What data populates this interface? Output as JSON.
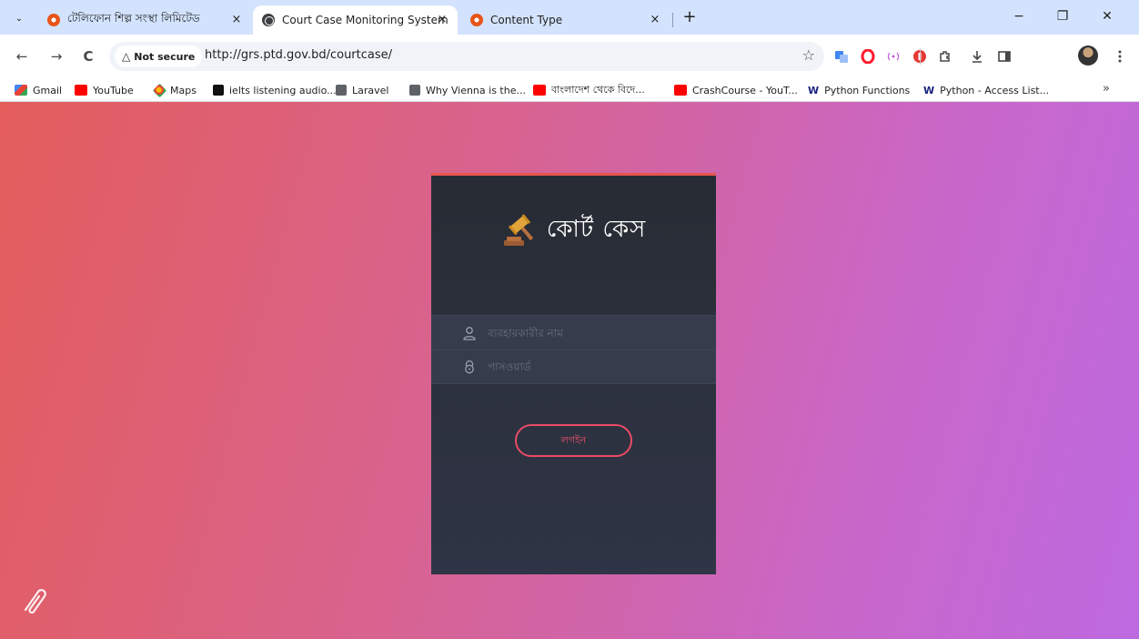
{
  "browser": {
    "tabs": [
      {
        "title": "টেলিফোন শিল্প সংস্থা লিমিটেড",
        "active": false,
        "favicon": "ptd-logo"
      },
      {
        "title": "Court Case Monitoring System",
        "active": true,
        "favicon": "globe-icon"
      },
      {
        "title": "Content Type",
        "active": false,
        "favicon": "ptd-logo"
      }
    ],
    "tab_close": "×",
    "new_tab": "+",
    "window": {
      "minimize": "−",
      "restore": "❐",
      "close": "✕"
    },
    "nav": {
      "back": "←",
      "forward": "→",
      "reload": "C"
    },
    "omnibox": {
      "security_icon": "△",
      "security_label": "Not secure",
      "url": "http://grs.ptd.gov.bd/courtcase/",
      "bookmark_star": "☆"
    },
    "bookmarks": [
      {
        "label": "Gmail",
        "icon": "gmail-icon"
      },
      {
        "label": "YouTube",
        "icon": "youtube-icon"
      },
      {
        "label": "Maps",
        "icon": "maps-icon"
      },
      {
        "label": "ielts listening audio...",
        "icon": "dot-icon"
      },
      {
        "label": "Laravel",
        "icon": "globe-icon"
      },
      {
        "label": "Why Vienna is the...",
        "icon": "globe-icon"
      },
      {
        "label": "বাংলাদেশ থেকে বিদে...",
        "icon": "youtube-icon"
      },
      {
        "label": "CrashCourse - YouT...",
        "icon": "youtube-icon"
      },
      {
        "label": "Python Functions",
        "icon": "w3schools-icon"
      },
      {
        "label": "Python - Access List...",
        "icon": "w3schools-icon"
      }
    ],
    "bookmarks_more": "»",
    "w_glyph": "W"
  },
  "login": {
    "brand_title": "কোর্ট কেস",
    "username_placeholder": "ব্যবহারকারীর নাম",
    "password_placeholder": "পাসওয়ার্ড",
    "submit_label": "লগইন"
  },
  "colors": {
    "accent": "#e8554e",
    "button_border": "#ea4c66",
    "gradient_start": "#e35d5b",
    "gradient_end": "#bd69e0",
    "card_bg": "#2b2f3a"
  }
}
